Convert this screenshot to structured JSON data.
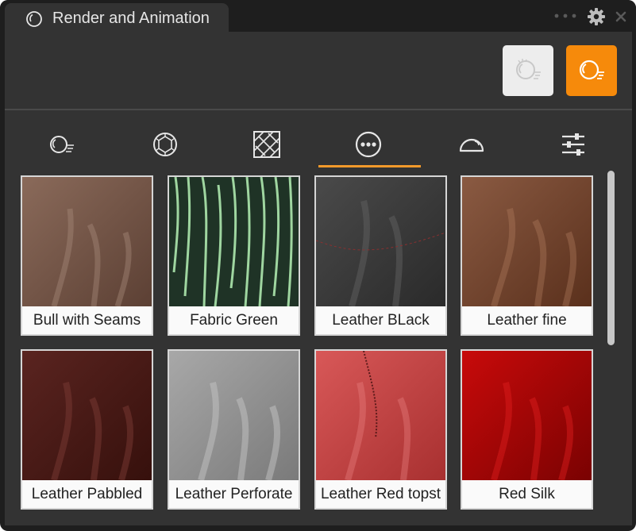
{
  "window": {
    "title": "Render and Animation"
  },
  "toolbar": {
    "buttons": [
      {
        "icon": "render-light-icon",
        "state": "inactive"
      },
      {
        "icon": "render-active-icon",
        "state": "active",
        "color": "#f68a0b"
      }
    ]
  },
  "categories": [
    {
      "icon": "material-sphere-icon"
    },
    {
      "icon": "gem-icon"
    },
    {
      "icon": "texture-pattern-icon"
    },
    {
      "icon": "more-options-icon",
      "selected": true
    },
    {
      "icon": "dome-icon"
    },
    {
      "icon": "sliders-icon"
    }
  ],
  "accent_color": "#f39a2b",
  "materials": [
    {
      "label": "Bull with Seams",
      "color": "#7a5a4c"
    },
    {
      "label": "Fabric Green",
      "color": "#23392b"
    },
    {
      "label": "Leather BLack",
      "color": "#3a3a3a"
    },
    {
      "label": "Leather fine",
      "color": "#7a4a30"
    },
    {
      "label": "Leather Pabbled",
      "color": "#4a1a16"
    },
    {
      "label": "Leather Perforate",
      "color": "#9a9a9a"
    },
    {
      "label": "Leather Red topst",
      "color": "#c94444"
    },
    {
      "label": "Red Silk",
      "color": "#a80404"
    }
  ]
}
